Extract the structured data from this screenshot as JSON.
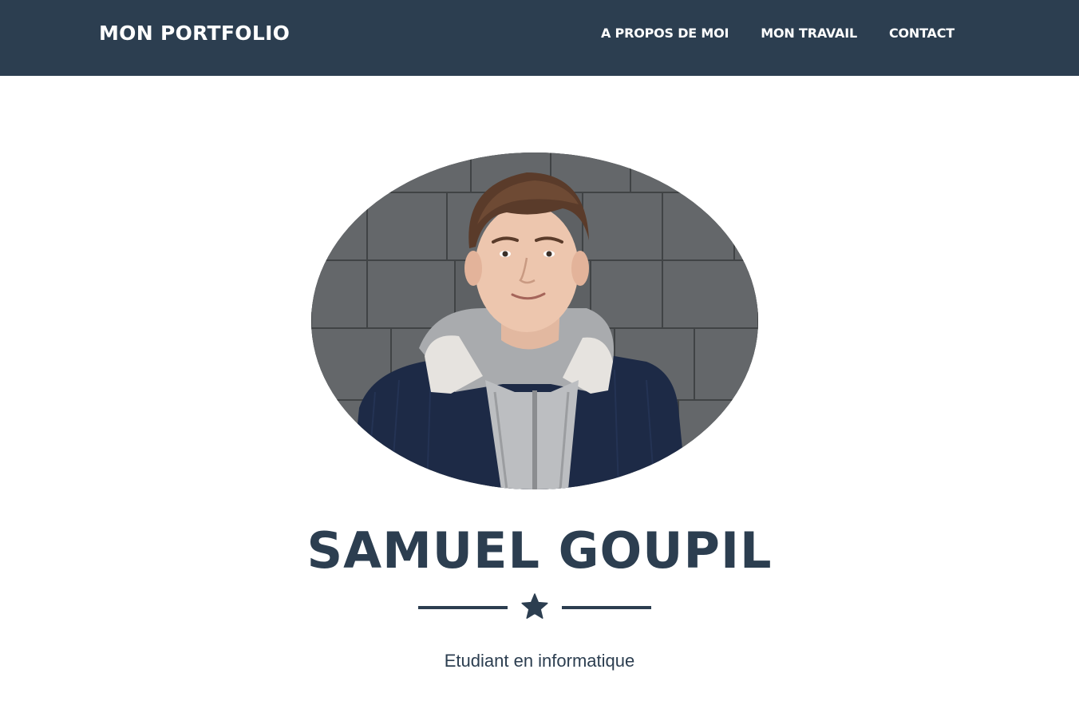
{
  "navbar": {
    "brand": "MON PORTFOLIO",
    "links": [
      {
        "label": "A PROPOS DE MOI"
      },
      {
        "label": "MON TRAVAIL"
      },
      {
        "label": "CONTACT"
      }
    ]
  },
  "hero": {
    "name": "SAMUEL GOUPIL",
    "subtitle": "Etudiant en informatique",
    "divider_icon": "star-icon"
  },
  "colors": {
    "navbar_bg": "#2c3e50",
    "primary_text": "#2c3e50",
    "nav_text": "#ffffff",
    "page_bg": "#ffffff"
  }
}
